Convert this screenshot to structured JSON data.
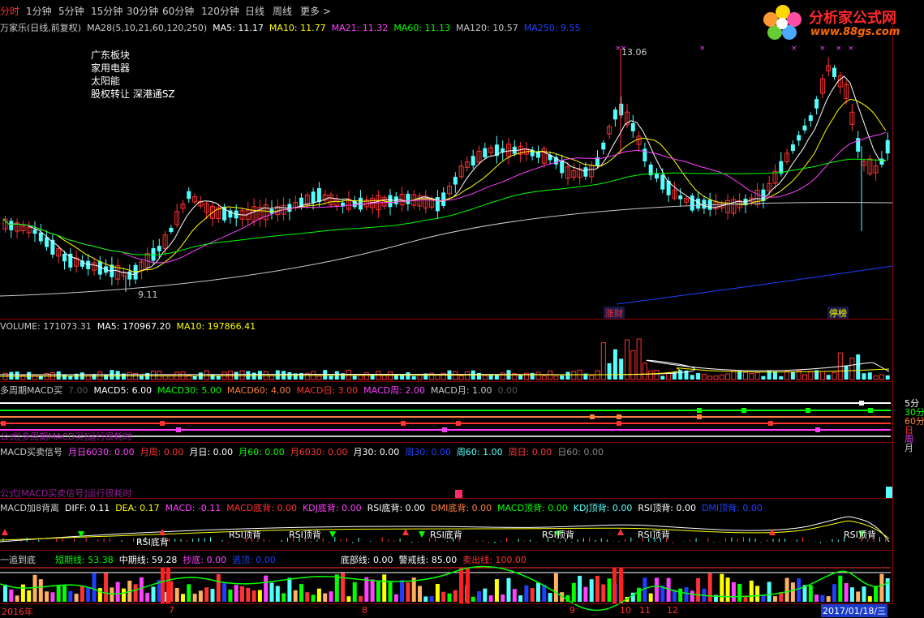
{
  "topbar": {
    "tabs": [
      "分时",
      "1分钟",
      "5分钟",
      "15分钟",
      "30分钟",
      "60分钟",
      "120分钟",
      "日线",
      "周线",
      "更多 >"
    ],
    "active_index": 0
  },
  "logo": {
    "title": "分析家公式网",
    "url": "www.88gs.com"
  },
  "main_legend": {
    "stock": "万家乐(日线,前复权)",
    "ma28": "MA28(5,10,21,60,120,250)",
    "ma5": "MA5: 11.17",
    "ma10": "MA10: 11.77",
    "ma21": "MA21: 11.32",
    "ma60": "MA60: 11.13",
    "ma120": "MA120: 10.57",
    "ma250": "MA250: 9.55"
  },
  "sectors": [
    "广东板块",
    "家用电器",
    "太阳能",
    "股权转让 深港通SZ"
  ],
  "price_high_label": "13.06",
  "price_low_label": "9.11",
  "tags": {
    "zhangcai": "涨财",
    "tingpai": "停榜"
  },
  "volume_legend": {
    "volume": "VOLUME: 171073.31",
    "ma5": "MA5: 170967.20",
    "ma10": "MA10: 197866.41"
  },
  "macd_multi_legend": {
    "name": "多周期MACD买",
    "zero": "7.00",
    "macd5": "MACD5: 6.00",
    "macd30": "MACD30: 5.00",
    "macd60": "MACD60: 4.00",
    "macd_day": "MACD日: 3.00",
    "macd_week": "MACD周: 2.00",
    "macd_month": "MACD月: 1.00",
    "zero2": "0.00"
  },
  "macd_multi_right_labels": [
    "5分",
    "30分",
    "60分",
    "日",
    "周",
    "月"
  ],
  "macd_multi_note": "公式[多周期MACD买]运行很耗时",
  "macd_signal_legend": {
    "name": "MACD买卖信号",
    "a": "月日6030: 0.00",
    "b": "月周: 0.00",
    "c": "月日: 0.00",
    "d": "月60: 0.00",
    "e": "月6030: 0.00",
    "f": "月30: 0.00",
    "g": "周30: 0.00",
    "h": "周60: 1.00",
    "i": "周日: 0.00",
    "j": "日60: 0.00"
  },
  "macd_signal_note": "公式[MACD买卖信号]运行很耗时",
  "macd8_legend": {
    "name": "MACD加8背离",
    "diff": "DIFF: 0.11",
    "dea": "DEA: 0.17",
    "macd": "MACD: -0.11",
    "macd_bottom": "MACD底背: 0.00",
    "kdj_bottom": "KDJ底背: 0.00",
    "rsi_bottom": "RSI底背: 0.00",
    "dmi_bottom": "DMI底背: 0.00",
    "macd_top": "MACD顶背: 0.00",
    "kdj_top": "KDJ顶背: 0.00",
    "rsi_top": "RSI顶背: 0.00",
    "dmi_top": "DMI顶背: 0.00"
  },
  "divergence_labels": [
    "RSI底背",
    "RSI顶背",
    "RSI顶背",
    "RSI底背",
    "RSI顶背",
    "RSI顶背",
    "RSI顶背"
  ],
  "bottom_legend": {
    "name": "一追到底",
    "short": "短期线: 53.38",
    "mid": "中期线: 59.28",
    "chaodi": "抄底: 0.00",
    "taoding": "逃顶: 0.00",
    "bottom_line": "底部线: 0.00",
    "alert_line": "警戒线: 85.00",
    "sell_line": "卖出线: 100.00"
  },
  "date_axis": [
    "2016年",
    "7",
    "8",
    "9",
    "10",
    "11",
    "12",
    "2017/01/18/三"
  ],
  "colors": {
    "up": "#ff3232",
    "down": "#54ffff",
    "ma5": "#ffffff",
    "ma10": "#ffff00",
    "ma21": "#ff40ff",
    "ma60": "#00ff00",
    "ma120": "#c8c8c8",
    "ma250": "#2040ff",
    "divider": "#8b0000"
  }
}
